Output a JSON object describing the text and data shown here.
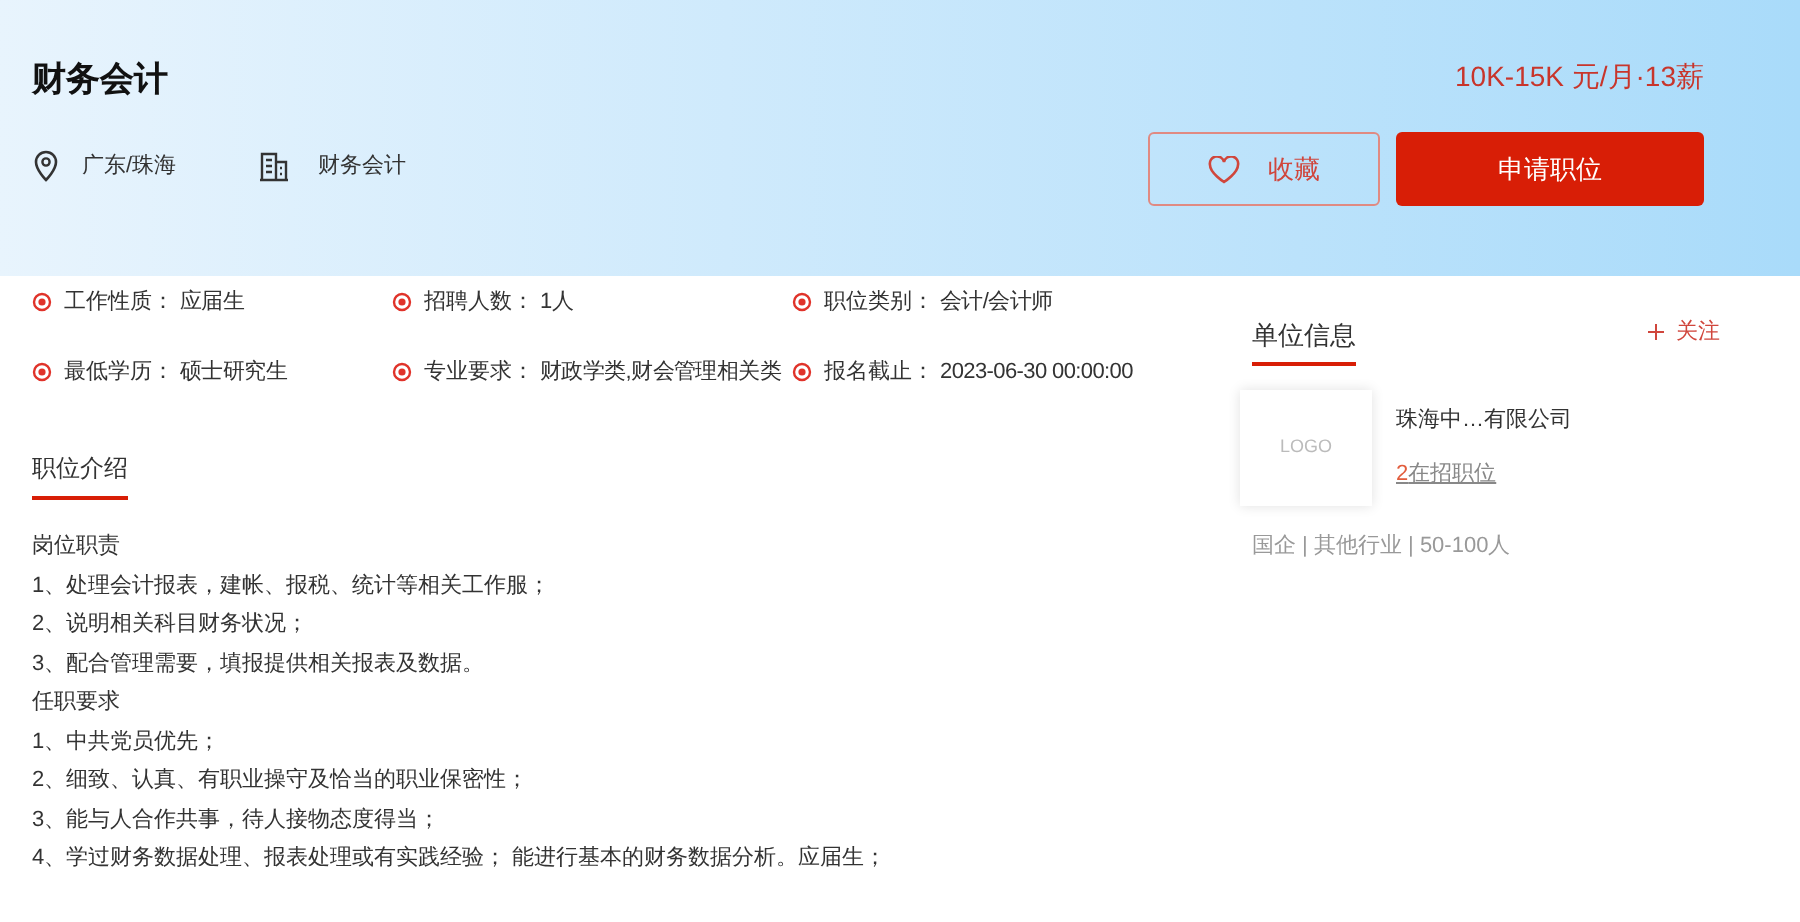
{
  "job": {
    "title": "财务会计",
    "location": "广东/珠海",
    "category": "财务会计",
    "salary": "10K-15K 元/月·13薪"
  },
  "buttons": {
    "favorite": "收藏",
    "apply": "申请职位"
  },
  "info": [
    {
      "label": "工作性质：",
      "value": "应届生"
    },
    {
      "label": "招聘人数：",
      "value": "1人"
    },
    {
      "label": "职位类别：",
      "value": "会计/会计师"
    },
    {
      "label": "最低学历：",
      "value": "硕士研究生"
    },
    {
      "label": "专业要求：",
      "value": "财政学类,财会管理相关类"
    },
    {
      "label": "报名截止：",
      "value": "2023-06-30 00:00:00"
    }
  ],
  "description": {
    "heading": "职位介绍",
    "lines": [
      "岗位职责",
      "1、处理会计报表，建帐、报税、统计等相关工作服；",
      "2、说明相关科目财务状况；",
      "3、配合管理需要，填报提供相关报表及数据。",
      "任职要求",
      "1、中共党员优先；",
      "2、细致、认真、有职业操守及恰当的职业保密性；",
      "3、能与人合作共事，待人接物态度得当；",
      "4、学过财务数据处理、报表处理或有实践经验； 能进行基本的财务数据分析。应届生；"
    ]
  },
  "company": {
    "tab": "单位信息",
    "follow": "关注",
    "logo": "LOGO",
    "name": "珠海中…有限公司",
    "open_count": "2",
    "open_label": "在招职位",
    "meta": "国企 | 其他行业 | 50-100人"
  }
}
